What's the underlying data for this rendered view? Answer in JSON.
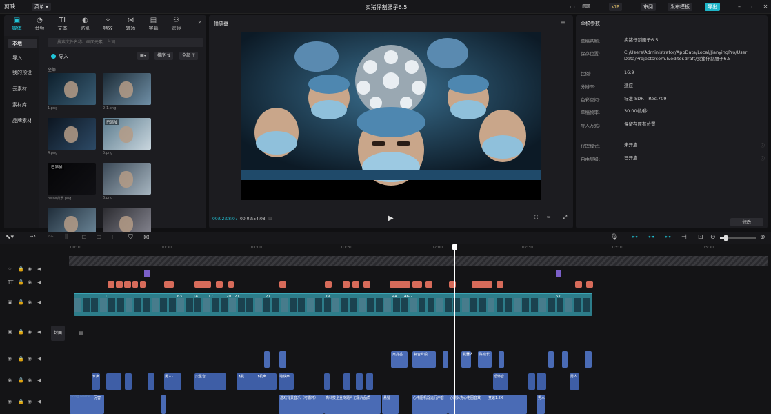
{
  "app": {
    "logo": "剪映",
    "menu_label": "菜单",
    "title": "卖猪仔割腰子6.5",
    "vip": "VIP",
    "review": "审阅",
    "publish": "发布模板",
    "export": "导出"
  },
  "media": {
    "tabs": [
      {
        "icon": "▣",
        "label": "媒体"
      },
      {
        "icon": "◔",
        "label": "音频"
      },
      {
        "icon": "TI",
        "label": "文本"
      },
      {
        "icon": "◐",
        "label": "贴纸"
      },
      {
        "icon": "✧",
        "label": "特效"
      },
      {
        "icon": "⋈",
        "label": "转场"
      },
      {
        "icon": "▤",
        "label": "字幕"
      },
      {
        "icon": "⚇",
        "label": "滤镜"
      }
    ],
    "more": "»",
    "sidebar": [
      "本地",
      "导入",
      "我的预设",
      "云素材",
      "素材库",
      "品牌素材"
    ],
    "search_placeholder": "搜索文件名称、画面元素、台词",
    "import_label": "导入",
    "sort_label": "排序",
    "filter_label": "全部",
    "section_label": "全部",
    "items": [
      {
        "caption": "1.png",
        "badge": ""
      },
      {
        "caption": "2-1.png",
        "badge": ""
      },
      {
        "caption": "4.png",
        "badge": ""
      },
      {
        "caption": "5.png",
        "badge": "已添加"
      },
      {
        "caption": "heise背景.png",
        "badge": "已添加"
      },
      {
        "caption": "6.png",
        "badge": ""
      },
      {
        "caption": "",
        "badge": ""
      },
      {
        "caption": "",
        "badge": ""
      }
    ]
  },
  "player": {
    "title": "播放器",
    "current_time": "00:02:08:07",
    "total_time": "00:02:54:08",
    "play_icon": "▶"
  },
  "draft": {
    "title": "草稿参数",
    "fields": [
      {
        "label": "草稿名称:",
        "value": "卖猪仔割腰子6.5"
      },
      {
        "label": "保存位置:",
        "value": "C:/Users/Administrator/AppData/Local/JianyingPro/User Data/Projects/com.lveditor.draft/卖猪仔割腰子6.5"
      },
      {
        "label": "比例:",
        "value": "16:9"
      },
      {
        "label": "分辨率:",
        "value": "适应"
      },
      {
        "label": "色彩空间:",
        "value": "标准 SDR - Rec.709"
      },
      {
        "label": "草稿帧率:",
        "value": "30.00帧/秒"
      },
      {
        "label": "导入方式:",
        "value": "保留在原有位置"
      },
      {
        "label": "代理模式:",
        "value": "未开启"
      },
      {
        "label": "自由层级:",
        "value": "已开启"
      }
    ],
    "edit_label": "修改"
  },
  "timeline": {
    "ticks": [
      "00:00",
      "00:30",
      "01:00",
      "01:30",
      "02:00",
      "02:30",
      "03:00",
      "03:30"
    ],
    "cover_label": "封面",
    "video_labels": [
      "1",
      "63",
      "14",
      "17",
      "21",
      "20",
      "27",
      "39",
      "44",
      "46-2",
      "57"
    ],
    "audio_clips_1": [
      "离兆岳",
      "复合片段",
      "机器人",
      "陈晓长"
    ],
    "audio_clips_2": [
      "水声",
      "男人-",
      "火星音",
      "飞机",
      "飞机声",
      "地铁声",
      "恐怖音",
      "男人"
    ],
    "audio_clips_3": [
      "厉害",
      "游戏背景音乐（可循环）",
      "高科技企业专题片记录片品质",
      "悬疑",
      "心电图机器运行声音",
      "心跳休克心电图音效",
      "变速1.2X",
      "男人"
    ],
    "track_label_voice": "Song Name"
  }
}
